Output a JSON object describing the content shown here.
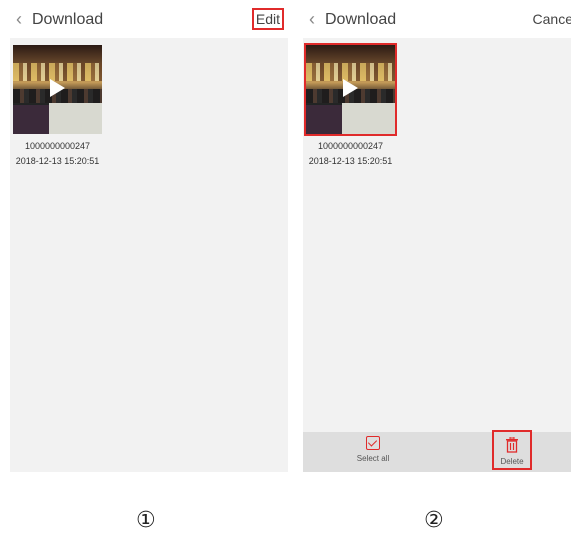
{
  "panels": [
    {
      "header": {
        "back_icon": "chevron-left-icon",
        "title": "Download",
        "action_label": "Edit"
      },
      "item": {
        "name": "1000000000247",
        "date": "2018-12-13 15:20:51"
      }
    },
    {
      "header": {
        "back_icon": "chevron-left-icon",
        "title": "Download",
        "action_label": "Cance"
      },
      "item": {
        "name": "1000000000247",
        "date": "2018-12-13 15:20:51"
      },
      "bottom_bar": {
        "select_all_label": "Select all",
        "delete_label": "Delete"
      }
    }
  ],
  "step_labels": [
    "①",
    "②"
  ],
  "colors": {
    "highlight": "#e02b2b",
    "panel_bg": "#f2f2f2",
    "bottom_bar_bg": "#dedede"
  }
}
